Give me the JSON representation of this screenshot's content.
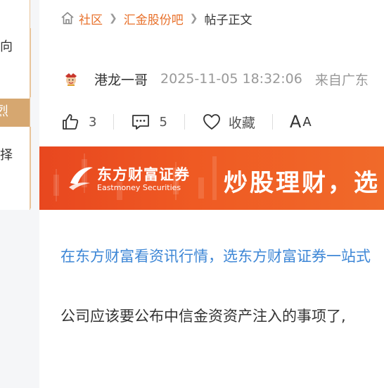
{
  "sidebar": {
    "items": [
      {
        "text": "向"
      },
      {
        "text": "烈"
      },
      {
        "text": "择"
      }
    ]
  },
  "breadcrumb": {
    "home_icon": "home-icon",
    "items": [
      "社区",
      "汇金股份吧"
    ],
    "current": "帖子正文"
  },
  "post": {
    "author": "港龙一哥",
    "time": "2025-11-05 18:32:06",
    "location": "来自广东",
    "body": "公司应该要公布中信金资资产注入的事项了,"
  },
  "actions": {
    "like_count": "3",
    "comment_count": "5",
    "collect_label": "收藏",
    "font_big": "A",
    "font_small": "A"
  },
  "banner": {
    "brand_cn": "东方财富证券",
    "brand_en": "Eastmoney Securities",
    "slogan": "炒股理财，选"
  },
  "promo": {
    "text": "在东方财富看资讯行情，选东方财富证券一站式"
  },
  "colors": {
    "accent": "#e8702a",
    "link": "#3e87d6",
    "banner": "#ef5a23",
    "sidebar_tan": "#d6a770"
  }
}
